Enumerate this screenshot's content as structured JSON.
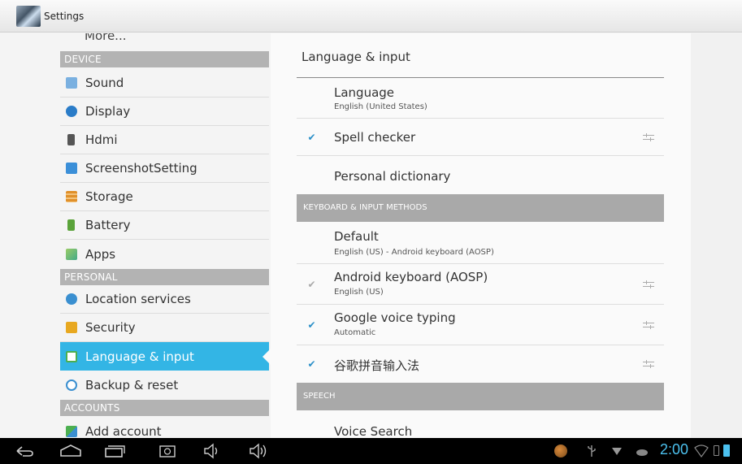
{
  "app": {
    "title": "Settings",
    "icon": "settings-app-icon"
  },
  "sidebar": {
    "more_label": "More...",
    "sections": [
      {
        "header": "DEVICE",
        "items": [
          {
            "label": "Sound",
            "icon": "sound-icon",
            "color": "#4a8fd0"
          },
          {
            "label": "Display",
            "icon": "display-icon",
            "color": "#2a7cc8"
          },
          {
            "label": "Hdmi",
            "icon": "hdmi-icon",
            "color": "#555555"
          },
          {
            "label": "ScreenshotSetting",
            "icon": "screenshot-icon",
            "color": "#3b8fd8"
          },
          {
            "label": "Storage",
            "icon": "storage-icon",
            "color": "#e0902a"
          },
          {
            "label": "Battery",
            "icon": "battery-icon",
            "color": "#5aa33a"
          },
          {
            "label": "Apps",
            "icon": "apps-icon",
            "color": "#7fbf4f"
          }
        ]
      },
      {
        "header": "PERSONAL",
        "items": [
          {
            "label": "Location services",
            "icon": "location-icon",
            "color": "#3a8fd0"
          },
          {
            "label": "Security",
            "icon": "lock-icon",
            "color": "#e8a820"
          },
          {
            "label": "Language & input",
            "icon": "language-icon",
            "color": "#4caf50",
            "active": true
          },
          {
            "label": "Backup & reset",
            "icon": "backup-icon",
            "color": "#3a8fd0"
          }
        ]
      },
      {
        "header": "ACCOUNTS",
        "items": [
          {
            "label": "Add account",
            "icon": "add-account-icon",
            "color": "#4caf50"
          }
        ]
      }
    ]
  },
  "content": {
    "title": "Language & input",
    "language": {
      "title": "Language",
      "summary": "English (United States)"
    },
    "spell_checker": {
      "title": "Spell checker",
      "checked": true
    },
    "personal_dictionary": {
      "title": "Personal dictionary"
    },
    "keyboard_header": "KEYBOARD & INPUT METHODS",
    "default": {
      "title": "Default",
      "summary": "English (US) - Android keyboard (AOSP)"
    },
    "android_keyboard": {
      "title": "Android keyboard (AOSP)",
      "summary": "English (US)",
      "checked": true,
      "disabled": true
    },
    "google_voice": {
      "title": "Google voice typing",
      "summary": "Automatic",
      "checked": true
    },
    "pinyin": {
      "title": "谷歌拼音输入法",
      "checked": true
    },
    "speech_header": "SPEECH",
    "voice_search": {
      "title": "Voice Search"
    }
  },
  "status_bar": {
    "time": "2:00",
    "accent": "#4cc1ef"
  },
  "colors": {
    "accent": "#33b5e5",
    "header_gray": "#b3b3b3"
  }
}
